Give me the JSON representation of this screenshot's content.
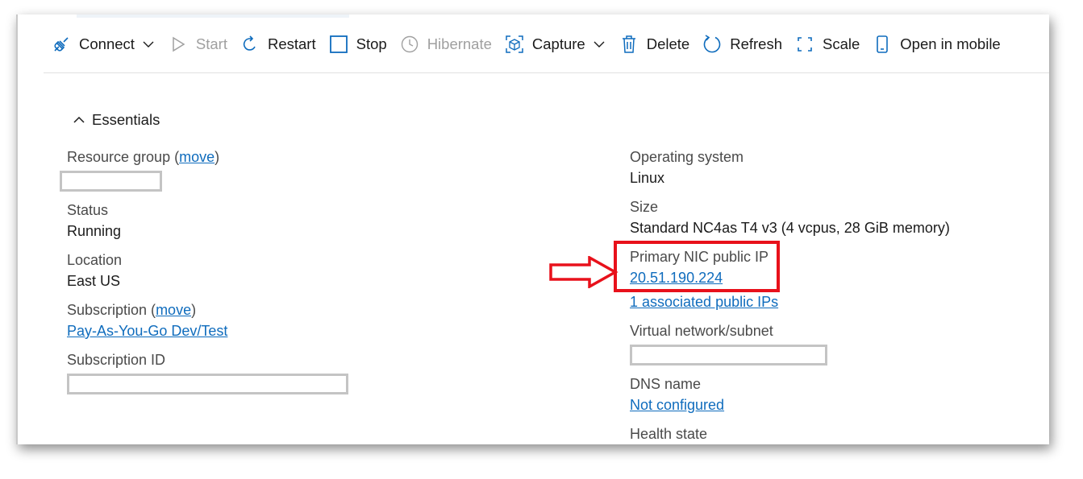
{
  "toolbar": {
    "connect": "Connect",
    "start": "Start",
    "restart": "Restart",
    "stop": "Stop",
    "hibernate": "Hibernate",
    "capture": "Capture",
    "delete": "Delete",
    "refresh": "Refresh",
    "scale": "Scale",
    "open_mobile": "Open in mobile"
  },
  "essentials": {
    "heading": "Essentials",
    "left": {
      "resource_group": {
        "label": "Resource group (",
        "move": "move",
        "close": ")"
      },
      "status": {
        "label": "Status",
        "value": "Running"
      },
      "location": {
        "label": "Location",
        "value": "East US"
      },
      "subscription": {
        "label": "Subscription (",
        "move": "move",
        "close": ")",
        "value": "Pay-As-You-Go Dev/Test"
      },
      "subscription_id": {
        "label": "Subscription ID"
      }
    },
    "right": {
      "os": {
        "label": "Operating system",
        "value": "Linux"
      },
      "size": {
        "label": "Size",
        "value": "Standard NC4as T4 v3 (4 vcpus, 28 GiB memory)"
      },
      "public_ip": {
        "label": "Primary NIC public IP",
        "value": "20.51.190.224",
        "associated": "1 associated public IPs"
      },
      "vnet": {
        "label": "Virtual network/subnet"
      },
      "dns": {
        "label": "DNS name",
        "value": "Not configured"
      },
      "health": {
        "label": "Health state"
      }
    }
  },
  "colors": {
    "link": "#0f6cbd",
    "highlight": "#e8111b",
    "icon_blue": "#0f6cbd",
    "disabled": "#a0a0a0"
  }
}
